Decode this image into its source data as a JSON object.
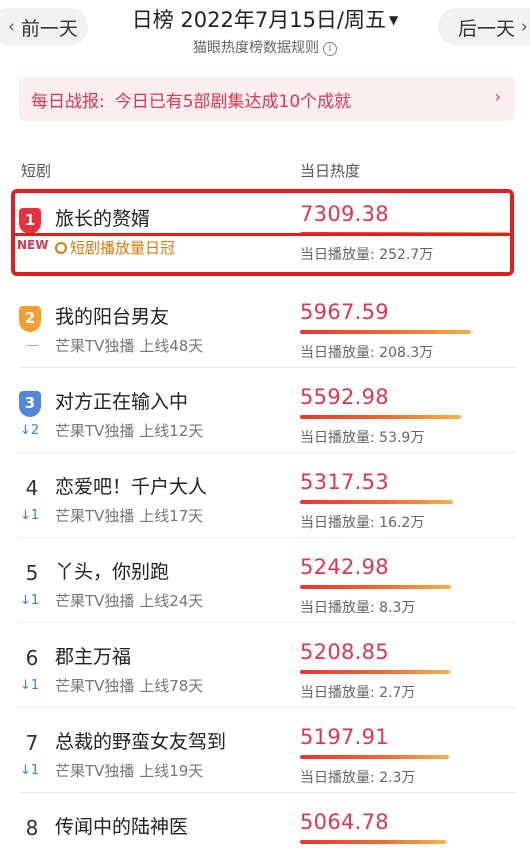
{
  "nav": {
    "prev_label": "前一天",
    "next_label": "后一天",
    "date_label": "日榜 2022年7月15日/周五",
    "rule_label": "猫眼热度榜数据规则"
  },
  "report": {
    "prefix": "每日战报:",
    "text": "今日已有5部剧集达成10个成就"
  },
  "columns": {
    "left": "短剧",
    "right": "当日热度"
  },
  "colors": {
    "accent": "#e0364f",
    "rank1": "#e8303e",
    "rank2": "#f3a12c",
    "rank3": "#4f86de",
    "trend_down": "#3b7ee0",
    "highlight_border": "#e0201e"
  },
  "items": [
    {
      "rank": "1",
      "trend": "NEW",
      "title": "旅长的赘婿",
      "sub": "短剧播放量日冠",
      "score": "7309.38",
      "bar_fraction": 1.0,
      "plays": "当日播放量: 252.7万"
    },
    {
      "rank": "2",
      "trend": "—",
      "title": "我的阳台男友",
      "sub": "芒果TV独播  上线48天",
      "score": "5967.59",
      "bar_fraction": 0.816,
      "plays": "当日播放量: 208.3万"
    },
    {
      "rank": "3",
      "trend": "↓2",
      "title": "对方正在输入中",
      "sub": "芒果TV独播  上线12天",
      "score": "5592.98",
      "bar_fraction": 0.765,
      "plays": "当日播放量: 53.9万"
    },
    {
      "rank": "4",
      "trend": "↓1",
      "title": "恋爱吧！千户大人",
      "sub": "芒果TV独播  上线17天",
      "score": "5317.53",
      "bar_fraction": 0.728,
      "plays": "当日播放量: 16.2万"
    },
    {
      "rank": "5",
      "trend": "↓1",
      "title": "丫头，你别跑",
      "sub": "芒果TV独播  上线24天",
      "score": "5242.98",
      "bar_fraction": 0.717,
      "plays": "当日播放量: 8.3万"
    },
    {
      "rank": "6",
      "trend": "↓1",
      "title": "郡主万福",
      "sub": "芒果TV独播  上线78天",
      "score": "5208.85",
      "bar_fraction": 0.713,
      "plays": "当日播放量: 2.7万"
    },
    {
      "rank": "7",
      "trend": "↓1",
      "title": "总裁的野蛮女友驾到",
      "sub": "芒果TV独播  上线19天",
      "score": "5197.91",
      "bar_fraction": 0.711,
      "plays": "当日播放量: 2.3万"
    },
    {
      "rank": "8",
      "trend": "",
      "title": "传闻中的陆神医",
      "sub": "",
      "score": "5064.78",
      "bar_fraction": 0.693,
      "plays": ""
    }
  ]
}
